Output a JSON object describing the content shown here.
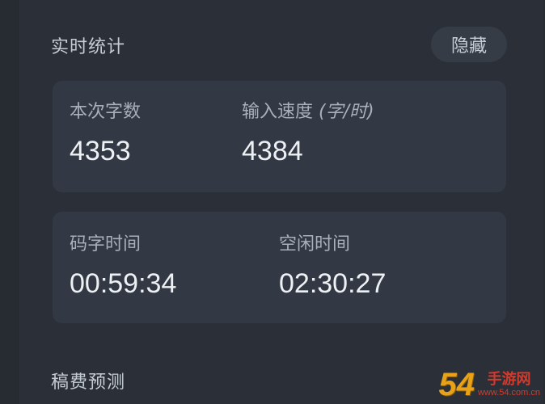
{
  "realtime": {
    "title": "实时统计",
    "hide_button": "隐藏"
  },
  "card1": {
    "chars_label": "本次字数",
    "chars_value": "4353",
    "speed_label": "输入速度",
    "speed_unit": "(字/时)",
    "speed_value": "4384"
  },
  "card2": {
    "typing_time_label": "码字时间",
    "typing_time_value": "00:59:34",
    "idle_time_label": "空闲时间",
    "idle_time_value": "02:30:27"
  },
  "estimate": {
    "title": "稿费预测"
  },
  "watermark": {
    "number": "54",
    "site": "手游网",
    "url": "www.54.com.cn"
  },
  "colors": {
    "background": "#2b3038",
    "card": "#323944",
    "text_primary": "#eef1f4",
    "text_secondary": "#a8b0ba"
  }
}
